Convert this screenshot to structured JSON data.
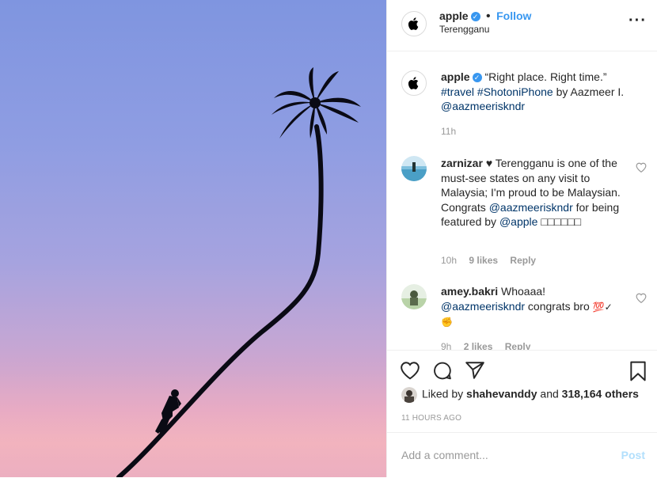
{
  "post": {
    "username": "apple",
    "follow_label": "Follow",
    "location": "Terengganu",
    "more_icon": "more-horizontal-icon",
    "photo_alt": "palm-tree-silhouette"
  },
  "caption": {
    "username": "apple",
    "text_quote": "“Right place. Right time.”",
    "hashtag1": "#travel",
    "hashtag2": "#ShotoniPhone",
    "by_text": "by Aazmeer I.",
    "mention": "@aazmeeriskndr",
    "time": "11h"
  },
  "comments": [
    {
      "username": "zarnizar",
      "text_a": "♥ Terengganu is one of the must-see states on any visit to Malaysia; I'm proud to be Malaysian. Congrats",
      "mention": "@aazmeeriskndr",
      "text_b": "for being featured by",
      "mention2": "@apple",
      "text_c": "□□□□□□",
      "time": "10h",
      "likes": "9 likes",
      "reply": "Reply"
    },
    {
      "username": "amey.bakri",
      "text_a": "Whoaaa!",
      "mention": "@aazmeeriskndr",
      "text_b": "congrats bro",
      "text_c": "💯✓✊",
      "time": "9h",
      "likes": "2 likes",
      "reply": "Reply"
    }
  ],
  "actions": {
    "like_icon": "heart-icon",
    "comment_icon": "comment-icon",
    "share_icon": "paper-plane-icon",
    "save_icon": "bookmark-icon"
  },
  "likes": {
    "prefix": "Liked by",
    "user": "shahevanddy",
    "and": "and",
    "count": "318,164 others"
  },
  "timestamp": "11 HOURS AGO",
  "add_comment": {
    "placeholder": "Add a comment...",
    "post_label": "Post"
  },
  "colors": {
    "accent": "#3897f0",
    "link": "#003569",
    "muted": "#999999"
  }
}
